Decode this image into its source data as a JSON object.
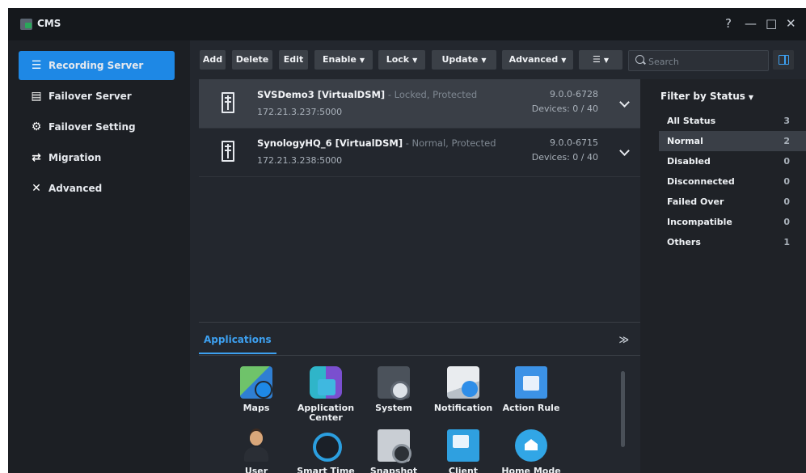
{
  "window": {
    "title": "CMS",
    "controls": {
      "help": "?",
      "minimize": "—",
      "maximize": "□",
      "close": "✕"
    }
  },
  "sidebar": {
    "items": [
      {
        "label": "Recording Server",
        "icon": "list-icon",
        "active": true
      },
      {
        "label": "Failover Server",
        "icon": "failover-server-icon",
        "active": false
      },
      {
        "label": "Failover Setting",
        "icon": "gear-icon",
        "active": false
      },
      {
        "label": "Migration",
        "icon": "migration-icon",
        "active": false
      },
      {
        "label": "Advanced",
        "icon": "tools-icon",
        "active": false
      }
    ]
  },
  "toolbar": {
    "add": "Add",
    "delete": "Delete",
    "edit": "Edit",
    "enable": "Enable",
    "lock": "Lock",
    "update": "Update",
    "advanced": "Advanced",
    "view_icon": "☰",
    "search_placeholder": "Search"
  },
  "servers": [
    {
      "name": "SVSDemo3 [VirtualDSM]",
      "status": " - Locked, Protected",
      "address": "172.21.3.237:5000",
      "version": "9.0.0-6728",
      "devices": "Devices: 0 / 40",
      "selected": true
    },
    {
      "name": "SynologyHQ_6 [VirtualDSM]",
      "status": " - Normal, Protected",
      "address": "172.21.3.238:5000",
      "version": "9.0.0-6715",
      "devices": "Devices: 0 / 40",
      "selected": false
    }
  ],
  "filter": {
    "title": "Filter by Status",
    "items": [
      {
        "label": "All Status",
        "count": "3"
      },
      {
        "label": "Normal",
        "count": "2",
        "active": true
      },
      {
        "label": "Disabled",
        "count": "0"
      },
      {
        "label": "Disconnected",
        "count": "0"
      },
      {
        "label": "Failed Over",
        "count": "0"
      },
      {
        "label": "Incompatible",
        "count": "0"
      },
      {
        "label": "Others",
        "count": "1"
      }
    ]
  },
  "applications": {
    "tab": "Applications",
    "collapse": "≫",
    "items": [
      {
        "label": "Maps",
        "icon": "maps-icon"
      },
      {
        "label": "Application\nCenter",
        "icon": "application-center-icon"
      },
      {
        "label": "System",
        "icon": "system-icon"
      },
      {
        "label": "Notification",
        "icon": "notification-icon"
      },
      {
        "label": "Action Rule",
        "icon": "action-rule-icon"
      },
      {
        "label": "User",
        "icon": "user-icon"
      },
      {
        "label": "Smart Time\nLapse",
        "icon": "smart-time-lapse-icon"
      },
      {
        "label": "Snapshot",
        "icon": "snapshot-icon"
      },
      {
        "label": "Client\nManagement",
        "icon": "client-management-icon"
      },
      {
        "label": "Home Mode",
        "icon": "home-mode-icon"
      }
    ]
  },
  "colors": {
    "accent": "#1e88e5",
    "background": "#23272e",
    "sidebar": "#1c1f24",
    "selected_row": "#3a3f47"
  }
}
